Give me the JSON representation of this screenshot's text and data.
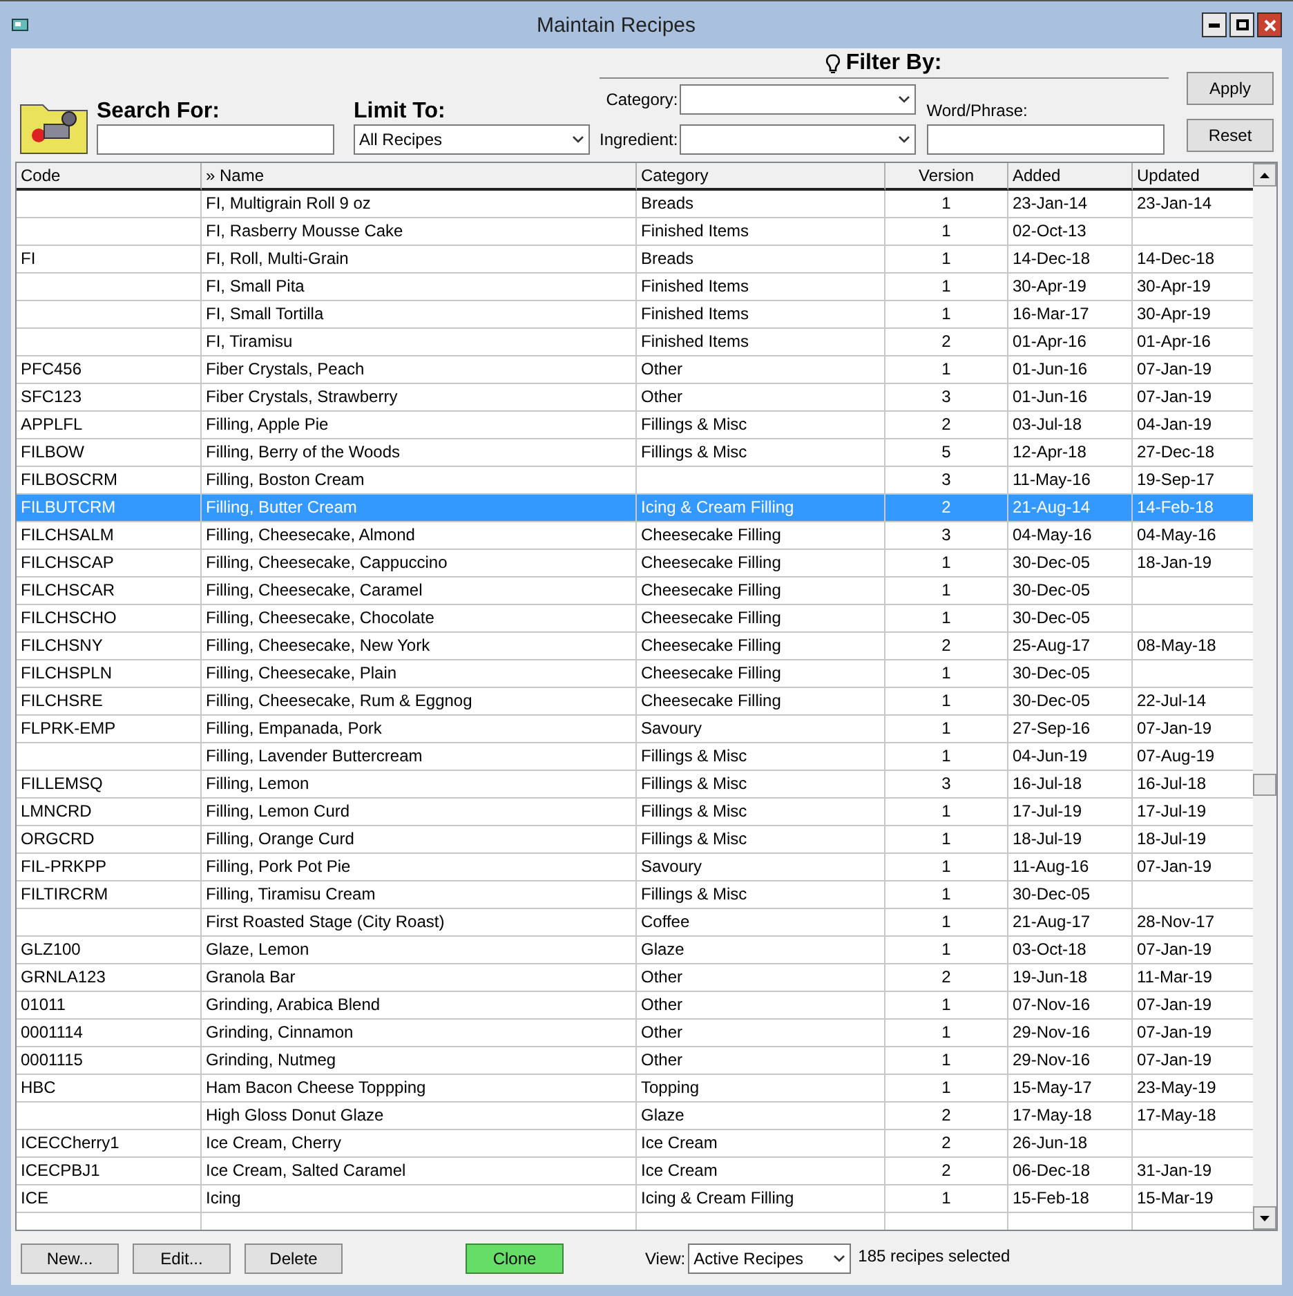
{
  "window": {
    "title": "Maintain Recipes"
  },
  "search": {
    "label": "Search For:"
  },
  "limit": {
    "label": "Limit To:",
    "value": "All Recipes"
  },
  "filter": {
    "title": "Filter By:",
    "category_label": "Category:",
    "ingredient_label": "Ingredient:",
    "word_label": "Word/Phrase:"
  },
  "filter_buttons": [
    "Apply",
    "Reset"
  ],
  "table": {
    "columns": [
      "Code",
      "» Name",
      "Category",
      "Version",
      "Added",
      "Updated"
    ],
    "rows": [
      {
        "cells": [
          "",
          "FI, Multigrain Roll 9 oz",
          "Breads",
          "1",
          "23-Jan-14",
          "23-Jan-14"
        ],
        "selected": false
      },
      {
        "cells": [
          "",
          "FI, Rasberry Mousse Cake",
          "Finished Items",
          "1",
          "02-Oct-13",
          ""
        ],
        "selected": false
      },
      {
        "cells": [
          "FI",
          "FI, Roll, Multi-Grain",
          "Breads",
          "1",
          "14-Dec-18",
          "14-Dec-18"
        ],
        "selected": false
      },
      {
        "cells": [
          "",
          "FI, Small Pita",
          "Finished Items",
          "1",
          "30-Apr-19",
          "30-Apr-19"
        ],
        "selected": false
      },
      {
        "cells": [
          "",
          "FI, Small Tortilla",
          "Finished Items",
          "1",
          "16-Mar-17",
          "30-Apr-19"
        ],
        "selected": false
      },
      {
        "cells": [
          "",
          "FI, Tiramisu",
          "Finished Items",
          "2",
          "01-Apr-16",
          "01-Apr-16"
        ],
        "selected": false
      },
      {
        "cells": [
          "PFC456",
          "Fiber Crystals, Peach",
          "Other",
          "1",
          "01-Jun-16",
          "07-Jan-19"
        ],
        "selected": false
      },
      {
        "cells": [
          "SFC123",
          "Fiber Crystals, Strawberry",
          "Other",
          "3",
          "01-Jun-16",
          "07-Jan-19"
        ],
        "selected": false
      },
      {
        "cells": [
          "APPLFL",
          "Filling, Apple Pie",
          "Fillings & Misc",
          "2",
          "03-Jul-18",
          "04-Jan-19"
        ],
        "selected": false
      },
      {
        "cells": [
          "FILBOW",
          "Filling, Berry of the Woods",
          "Fillings & Misc",
          "5",
          "12-Apr-18",
          "27-Dec-18"
        ],
        "selected": false
      },
      {
        "cells": [
          "FILBOSCRM",
          "Filling, Boston Cream",
          "",
          "3",
          "11-May-16",
          "19-Sep-17"
        ],
        "selected": false
      },
      {
        "cells": [
          "FILBUTCRM",
          "Filling, Butter Cream",
          "Icing & Cream Filling",
          "2",
          "21-Aug-14",
          "14-Feb-18"
        ],
        "selected": true
      },
      {
        "cells": [
          "FILCHSALM",
          "Filling, Cheesecake, Almond",
          "Cheesecake Filling",
          "3",
          "04-May-16",
          "04-May-16"
        ],
        "selected": false
      },
      {
        "cells": [
          "FILCHSCAP",
          "Filling, Cheesecake, Cappuccino",
          "Cheesecake Filling",
          "1",
          "30-Dec-05",
          "18-Jan-19"
        ],
        "selected": false
      },
      {
        "cells": [
          "FILCHSCAR",
          "Filling, Cheesecake, Caramel",
          "Cheesecake Filling",
          "1",
          "30-Dec-05",
          ""
        ],
        "selected": false
      },
      {
        "cells": [
          "FILCHSCHO",
          "Filling, Cheesecake, Chocolate",
          "Cheesecake Filling",
          "1",
          "30-Dec-05",
          ""
        ],
        "selected": false
      },
      {
        "cells": [
          "FILCHSNY",
          "Filling, Cheesecake, New York",
          "Cheesecake Filling",
          "2",
          "25-Aug-17",
          "08-May-18"
        ],
        "selected": false
      },
      {
        "cells": [
          "FILCHSPLN",
          "Filling, Cheesecake, Plain",
          "Cheesecake Filling",
          "1",
          "30-Dec-05",
          ""
        ],
        "selected": false
      },
      {
        "cells": [
          "FILCHSRE",
          "Filling, Cheesecake, Rum & Eggnog",
          "Cheesecake Filling",
          "1",
          "30-Dec-05",
          "22-Jul-14"
        ],
        "selected": false
      },
      {
        "cells": [
          "FLPRK-EMP",
          "Filling, Empanada, Pork",
          "Savoury",
          "1",
          "27-Sep-16",
          "07-Jan-19"
        ],
        "selected": false
      },
      {
        "cells": [
          "",
          "Filling, Lavender Buttercream",
          "Fillings & Misc",
          "1",
          "04-Jun-19",
          "07-Aug-19"
        ],
        "selected": false
      },
      {
        "cells": [
          "FILLEMSQ",
          "Filling, Lemon",
          "Fillings & Misc",
          "3",
          "16-Jul-18",
          "16-Jul-18"
        ],
        "selected": false
      },
      {
        "cells": [
          "LMNCRD",
          "Filling, Lemon Curd",
          "Fillings & Misc",
          "1",
          "17-Jul-19",
          "17-Jul-19"
        ],
        "selected": false
      },
      {
        "cells": [
          "ORGCRD",
          "Filling, Orange Curd",
          "Fillings & Misc",
          "1",
          "18-Jul-19",
          "18-Jul-19"
        ],
        "selected": false
      },
      {
        "cells": [
          "FIL-PRKPP",
          "Filling, Pork Pot Pie",
          "Savoury",
          "1",
          "11-Aug-16",
          "07-Jan-19"
        ],
        "selected": false
      },
      {
        "cells": [
          "FILTIRCRM",
          "Filling, Tiramisu Cream",
          "Fillings & Misc",
          "1",
          "30-Dec-05",
          ""
        ],
        "selected": false
      },
      {
        "cells": [
          "",
          "First Roasted Stage (City Roast)",
          "Coffee",
          "1",
          "21-Aug-17",
          "28-Nov-17"
        ],
        "selected": false
      },
      {
        "cells": [
          "GLZ100",
          "Glaze, Lemon",
          "Glaze",
          "1",
          "03-Oct-18",
          "07-Jan-19"
        ],
        "selected": false
      },
      {
        "cells": [
          "GRNLA123",
          "Granola Bar",
          "Other",
          "2",
          "19-Jun-18",
          "11-Mar-19"
        ],
        "selected": false
      },
      {
        "cells": [
          "01011",
          "Grinding, Arabica Blend",
          "Other",
          "1",
          "07-Nov-16",
          "07-Jan-19"
        ],
        "selected": false
      },
      {
        "cells": [
          "0001114",
          "Grinding, Cinnamon",
          "Other",
          "1",
          "29-Nov-16",
          "07-Jan-19"
        ],
        "selected": false
      },
      {
        "cells": [
          "0001115",
          "Grinding, Nutmeg",
          "Other",
          "1",
          "29-Nov-16",
          "07-Jan-19"
        ],
        "selected": false
      },
      {
        "cells": [
          "HBC",
          "Ham Bacon Cheese Toppping",
          "Topping",
          "1",
          "15-May-17",
          "23-May-19"
        ],
        "selected": false
      },
      {
        "cells": [
          "",
          "High Gloss Donut Glaze",
          "Glaze",
          "2",
          "17-May-18",
          "17-May-18"
        ],
        "selected": false
      },
      {
        "cells": [
          "ICECCherry1",
          "Ice Cream, Cherry",
          "Ice Cream",
          "2",
          "26-Jun-18",
          ""
        ],
        "selected": false
      },
      {
        "cells": [
          "ICECPBJ1",
          "Ice Cream, Salted Caramel",
          "Ice Cream",
          "2",
          "06-Dec-18",
          "31-Jan-19"
        ],
        "selected": false
      },
      {
        "cells": [
          "ICE",
          "Icing",
          "Icing & Cream Filling",
          "1",
          "15-Feb-18",
          "15-Mar-19"
        ],
        "selected": false
      }
    ]
  },
  "footer": {
    "buttons": [
      {
        "label": "New...",
        "kind": "plain"
      },
      {
        "label": "Edit...",
        "kind": "plain"
      },
      {
        "label": "Delete",
        "kind": "plain"
      },
      {
        "label": "Clone",
        "kind": "accent"
      }
    ],
    "view_label": "View:",
    "view_value": "Active Recipes",
    "status": "185 recipes selected"
  }
}
